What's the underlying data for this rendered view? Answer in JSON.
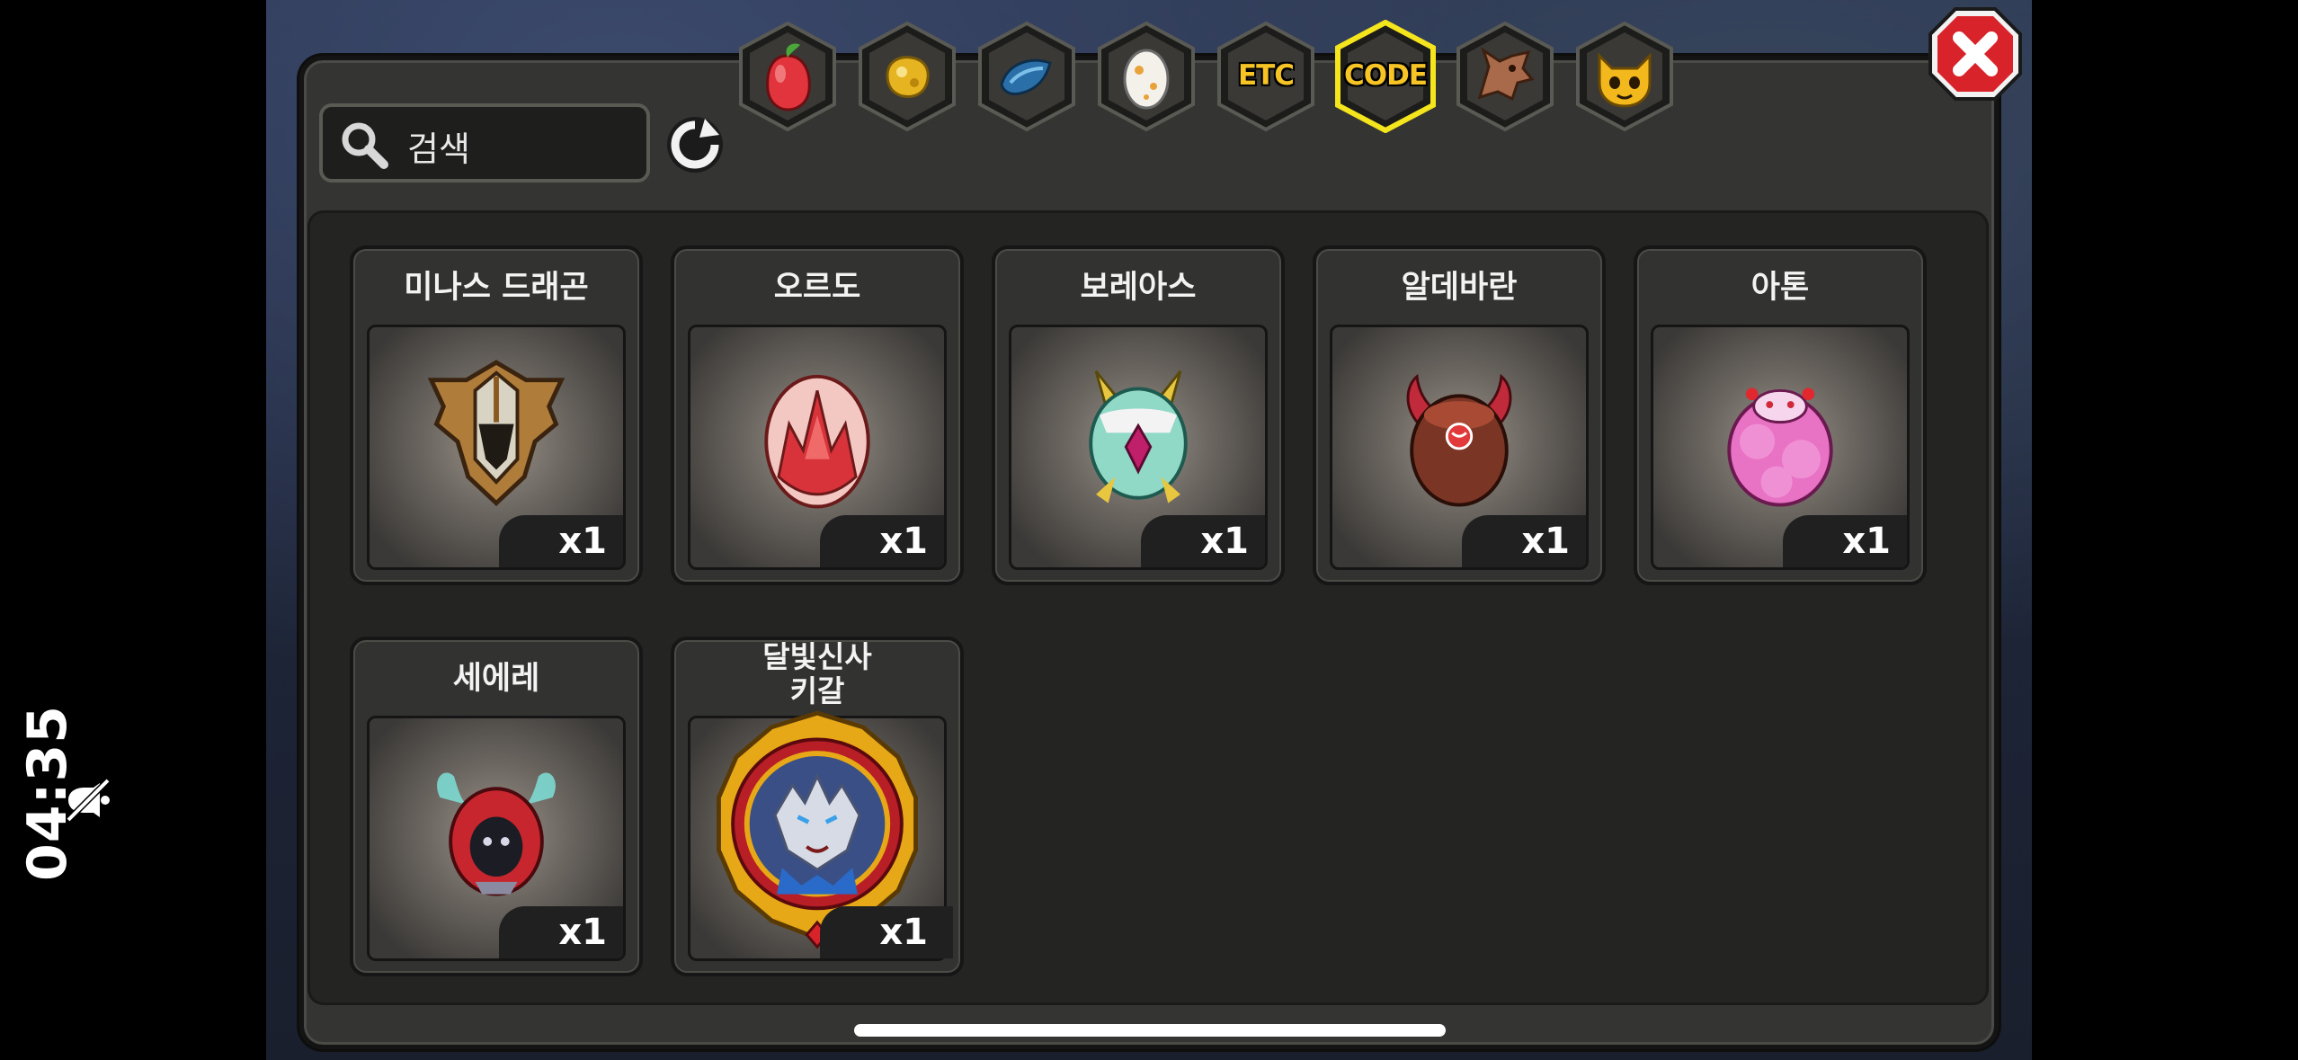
{
  "status_bar": {
    "time": "04:35",
    "mute_icon": "bell-slash-icon"
  },
  "search": {
    "placeholder": "검색",
    "icon": "search-icon"
  },
  "refresh_icon": "refresh-icon",
  "tabs": [
    {
      "name": "fruit",
      "icon": "fruit-icon",
      "label": ""
    },
    {
      "name": "gold",
      "icon": "gold-nugget-icon",
      "label": ""
    },
    {
      "name": "scale",
      "icon": "blue-scale-icon",
      "label": ""
    },
    {
      "name": "egg",
      "icon": "egg-icon",
      "label": ""
    },
    {
      "name": "etc",
      "icon": "",
      "label": "ETC"
    },
    {
      "name": "code",
      "icon": "",
      "label": "CODE",
      "active": true
    },
    {
      "name": "dragon",
      "icon": "dragon-head-icon",
      "label": ""
    },
    {
      "name": "mascot",
      "icon": "mascot-icon",
      "label": ""
    }
  ],
  "close_icon": "close-icon",
  "items": [
    {
      "name": "미나스 드래곤",
      "count": "x1",
      "art": "winged-helmet"
    },
    {
      "name": "오르도",
      "count": "x1",
      "art": "red-crystal-egg"
    },
    {
      "name": "보레아스",
      "count": "x1",
      "art": "winged-green-egg"
    },
    {
      "name": "알데바란",
      "count": "x1",
      "art": "horned-bull-egg"
    },
    {
      "name": "아톤",
      "count": "x1",
      "art": "pink-fluffy-egg"
    },
    {
      "name": "세에레",
      "count": "x1",
      "art": "hooded-red-egg"
    },
    {
      "name": "달빛신사\n키갈",
      "count": "x1",
      "art": "wolf-portrait-medal"
    }
  ],
  "colors": {
    "active_tab_outline": "#f5e51c",
    "tab_label": "#f6c424",
    "close_red": "#d8232a"
  }
}
